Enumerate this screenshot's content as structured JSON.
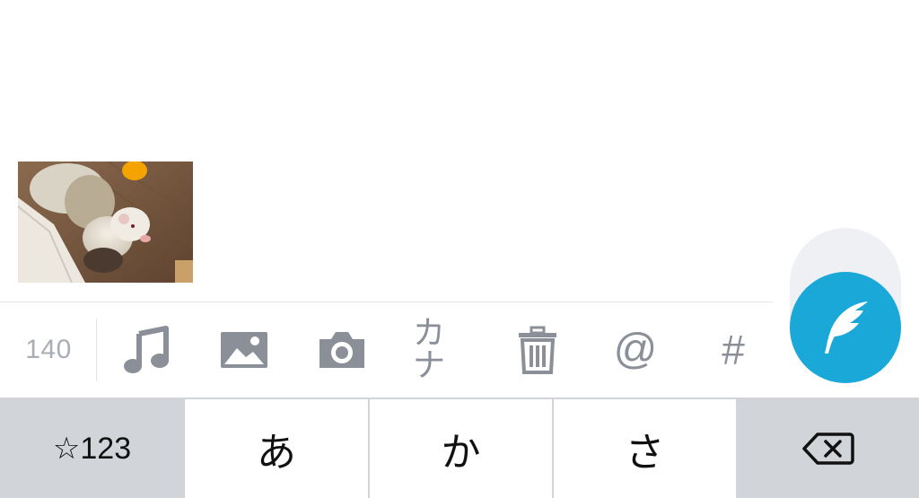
{
  "composer": {
    "attachment_image": "ferret-photo",
    "char_count": "140"
  },
  "toolbar": {
    "items": [
      {
        "name": "music-icon"
      },
      {
        "name": "image-icon"
      },
      {
        "name": "camera-icon"
      },
      {
        "name": "katakana-button",
        "label": "カナ"
      },
      {
        "name": "trash-icon"
      },
      {
        "name": "mention-button",
        "label": "@"
      },
      {
        "name": "hashtag-button",
        "label": "#"
      }
    ]
  },
  "compose_button": {
    "icon": "quill-feather-icon",
    "color": "#1aa8d8"
  },
  "keyboard": {
    "mode_key": "☆123",
    "keys": [
      "あ",
      "か",
      "さ"
    ],
    "delete_icon": "backspace-icon"
  }
}
